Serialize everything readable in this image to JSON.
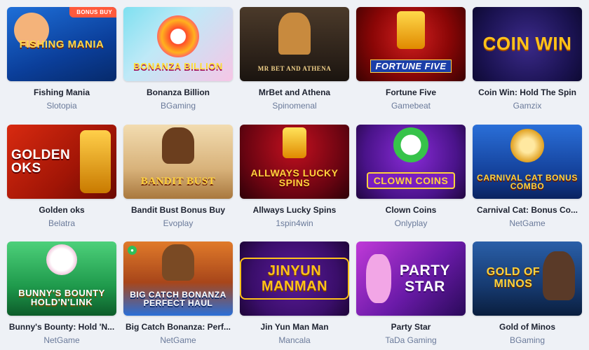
{
  "games": [
    {
      "name": "Fishing Mania",
      "provider": "Slotopia",
      "art": "FISHING MANIA",
      "badge": "BONUS BUY"
    },
    {
      "name": "Bonanza Billion",
      "provider": "BGaming",
      "art": "BONANZA BILLION"
    },
    {
      "name": "MrBet and Athena",
      "provider": "Spinomenal",
      "art": "MR BET AND ATHENA"
    },
    {
      "name": "Fortune Five",
      "provider": "Gamebeat",
      "art": "FORTUNE FIVE"
    },
    {
      "name": "Coin Win: Hold The Spin",
      "provider": "Gamzix",
      "art": "COIN WIN"
    },
    {
      "name": "Golden oks",
      "provider": "Belatra",
      "art": "GOLDEN OKS"
    },
    {
      "name": "Bandit Bust Bonus Buy",
      "provider": "Evoplay",
      "art": "BANDIT BUST"
    },
    {
      "name": "Allways Lucky Spins",
      "provider": "1spin4win",
      "art": "ALLWAYS LUCKY SPINS"
    },
    {
      "name": "Clown Coins",
      "provider": "Onlyplay",
      "art": "CLOWN COINS"
    },
    {
      "name": "Carnival Cat: Bonus Co...",
      "provider": "NetGame",
      "art": "CARNIVAL CAT BONUS COMBO"
    },
    {
      "name": "Bunny's Bounty: Hold 'N...",
      "provider": "NetGame",
      "art": "BUNNY'S BOUNTY HOLD'N'LINK"
    },
    {
      "name": "Big Catch Bonanza: Perf...",
      "provider": "NetGame",
      "art": "BIG CATCH BONANZA PERFECT HAUL",
      "chat_icon": true
    },
    {
      "name": "Jin Yun Man Man",
      "provider": "Mancala",
      "art": "JINYUN MANMAN"
    },
    {
      "name": "Party Star",
      "provider": "TaDa Gaming",
      "art": "PARTY STAR"
    },
    {
      "name": "Gold of Minos",
      "provider": "BGaming",
      "art": "GOLD OF MINOS"
    }
  ]
}
